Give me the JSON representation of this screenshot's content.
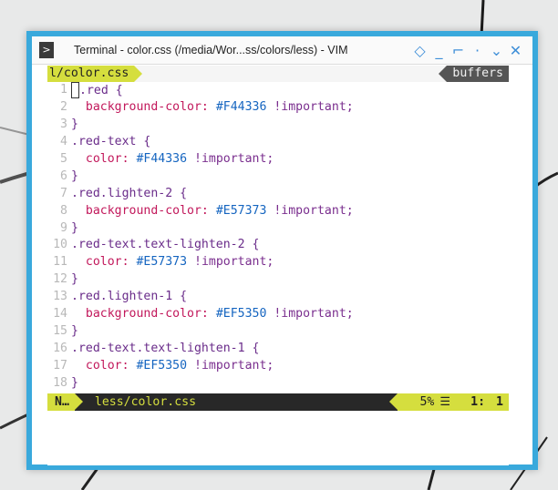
{
  "window": {
    "title": "Terminal - color.css (/media/Wor...ss/colors/less) - VIM",
    "controls": {
      "sticky": "◇",
      "minimize": "_",
      "maximize": "⌐",
      "shade": "·",
      "rollup": "⌄",
      "close": "✕"
    }
  },
  "tabline": {
    "active_tab": "l/color.css",
    "buffers_label": "buffers"
  },
  "code_lines": [
    {
      "n": "1",
      "sel": ".red {",
      "prop": "",
      "val": "",
      "imp": ""
    },
    {
      "n": "2",
      "sel": "",
      "prop": "background-color:",
      "val": "#F44336",
      "imp": "!important;"
    },
    {
      "n": "3",
      "sel": "}",
      "prop": "",
      "val": "",
      "imp": ""
    },
    {
      "n": "4",
      "sel": ".red-text {",
      "prop": "",
      "val": "",
      "imp": ""
    },
    {
      "n": "5",
      "sel": "",
      "prop": "color:",
      "val": "#F44336",
      "imp": "!important;"
    },
    {
      "n": "6",
      "sel": "}",
      "prop": "",
      "val": "",
      "imp": ""
    },
    {
      "n": "7",
      "sel": ".red.lighten-2 {",
      "prop": "",
      "val": "",
      "imp": ""
    },
    {
      "n": "8",
      "sel": "",
      "prop": "background-color:",
      "val": "#E57373",
      "imp": "!important;"
    },
    {
      "n": "9",
      "sel": "}",
      "prop": "",
      "val": "",
      "imp": ""
    },
    {
      "n": "10",
      "sel": ".red-text.text-lighten-2 {",
      "prop": "",
      "val": "",
      "imp": ""
    },
    {
      "n": "11",
      "sel": "",
      "prop": "color:",
      "val": "#E57373",
      "imp": "!important;"
    },
    {
      "n": "12",
      "sel": "}",
      "prop": "",
      "val": "",
      "imp": ""
    },
    {
      "n": "13",
      "sel": ".red.lighten-1 {",
      "prop": "",
      "val": "",
      "imp": ""
    },
    {
      "n": "14",
      "sel": "",
      "prop": "background-color:",
      "val": "#EF5350",
      "imp": "!important;"
    },
    {
      "n": "15",
      "sel": "}",
      "prop": "",
      "val": "",
      "imp": ""
    },
    {
      "n": "16",
      "sel": ".red-text.text-lighten-1 {",
      "prop": "",
      "val": "",
      "imp": ""
    },
    {
      "n": "17",
      "sel": "",
      "prop": "color:",
      "val": "#EF5350",
      "imp": "!important;"
    },
    {
      "n": "18",
      "sel": "}",
      "prop": "",
      "val": "",
      "imp": ""
    }
  ],
  "statusline": {
    "mode": "N…",
    "filename": "less/color.css",
    "percent": "5%",
    "line_icon": "☰",
    "line": "1:",
    "column": "1"
  },
  "colors": {
    "accent": "#39a9dc",
    "statusline_bg": "#282828",
    "statusline_accent": "#d5de3e",
    "selector": "#6a2c8a",
    "property": "#c2185b",
    "value": "#1565c0"
  }
}
